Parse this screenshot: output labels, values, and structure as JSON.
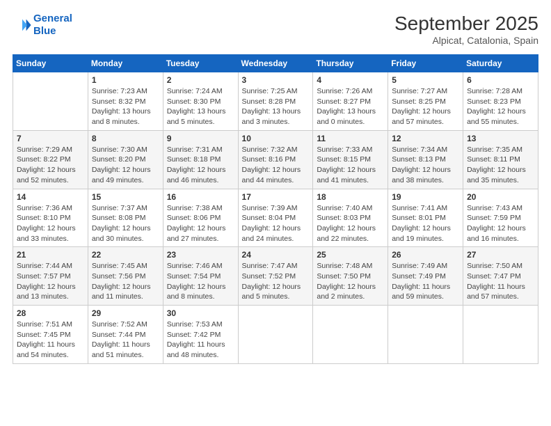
{
  "header": {
    "logo_line1": "General",
    "logo_line2": "Blue",
    "main_title": "September 2025",
    "subtitle": "Alpicat, Catalonia, Spain"
  },
  "days_of_week": [
    "Sunday",
    "Monday",
    "Tuesday",
    "Wednesday",
    "Thursday",
    "Friday",
    "Saturday"
  ],
  "weeks": [
    [
      {
        "day": "",
        "info": ""
      },
      {
        "day": "1",
        "info": "Sunrise: 7:23 AM\nSunset: 8:32 PM\nDaylight: 13 hours\nand 8 minutes."
      },
      {
        "day": "2",
        "info": "Sunrise: 7:24 AM\nSunset: 8:30 PM\nDaylight: 13 hours\nand 5 minutes."
      },
      {
        "day": "3",
        "info": "Sunrise: 7:25 AM\nSunset: 8:28 PM\nDaylight: 13 hours\nand 3 minutes."
      },
      {
        "day": "4",
        "info": "Sunrise: 7:26 AM\nSunset: 8:27 PM\nDaylight: 13 hours\nand 0 minutes."
      },
      {
        "day": "5",
        "info": "Sunrise: 7:27 AM\nSunset: 8:25 PM\nDaylight: 12 hours\nand 57 minutes."
      },
      {
        "day": "6",
        "info": "Sunrise: 7:28 AM\nSunset: 8:23 PM\nDaylight: 12 hours\nand 55 minutes."
      }
    ],
    [
      {
        "day": "7",
        "info": "Sunrise: 7:29 AM\nSunset: 8:22 PM\nDaylight: 12 hours\nand 52 minutes."
      },
      {
        "day": "8",
        "info": "Sunrise: 7:30 AM\nSunset: 8:20 PM\nDaylight: 12 hours\nand 49 minutes."
      },
      {
        "day": "9",
        "info": "Sunrise: 7:31 AM\nSunset: 8:18 PM\nDaylight: 12 hours\nand 46 minutes."
      },
      {
        "day": "10",
        "info": "Sunrise: 7:32 AM\nSunset: 8:16 PM\nDaylight: 12 hours\nand 44 minutes."
      },
      {
        "day": "11",
        "info": "Sunrise: 7:33 AM\nSunset: 8:15 PM\nDaylight: 12 hours\nand 41 minutes."
      },
      {
        "day": "12",
        "info": "Sunrise: 7:34 AM\nSunset: 8:13 PM\nDaylight: 12 hours\nand 38 minutes."
      },
      {
        "day": "13",
        "info": "Sunrise: 7:35 AM\nSunset: 8:11 PM\nDaylight: 12 hours\nand 35 minutes."
      }
    ],
    [
      {
        "day": "14",
        "info": "Sunrise: 7:36 AM\nSunset: 8:10 PM\nDaylight: 12 hours\nand 33 minutes."
      },
      {
        "day": "15",
        "info": "Sunrise: 7:37 AM\nSunset: 8:08 PM\nDaylight: 12 hours\nand 30 minutes."
      },
      {
        "day": "16",
        "info": "Sunrise: 7:38 AM\nSunset: 8:06 PM\nDaylight: 12 hours\nand 27 minutes."
      },
      {
        "day": "17",
        "info": "Sunrise: 7:39 AM\nSunset: 8:04 PM\nDaylight: 12 hours\nand 24 minutes."
      },
      {
        "day": "18",
        "info": "Sunrise: 7:40 AM\nSunset: 8:03 PM\nDaylight: 12 hours\nand 22 minutes."
      },
      {
        "day": "19",
        "info": "Sunrise: 7:41 AM\nSunset: 8:01 PM\nDaylight: 12 hours\nand 19 minutes."
      },
      {
        "day": "20",
        "info": "Sunrise: 7:43 AM\nSunset: 7:59 PM\nDaylight: 12 hours\nand 16 minutes."
      }
    ],
    [
      {
        "day": "21",
        "info": "Sunrise: 7:44 AM\nSunset: 7:57 PM\nDaylight: 12 hours\nand 13 minutes."
      },
      {
        "day": "22",
        "info": "Sunrise: 7:45 AM\nSunset: 7:56 PM\nDaylight: 12 hours\nand 11 minutes."
      },
      {
        "day": "23",
        "info": "Sunrise: 7:46 AM\nSunset: 7:54 PM\nDaylight: 12 hours\nand 8 minutes."
      },
      {
        "day": "24",
        "info": "Sunrise: 7:47 AM\nSunset: 7:52 PM\nDaylight: 12 hours\nand 5 minutes."
      },
      {
        "day": "25",
        "info": "Sunrise: 7:48 AM\nSunset: 7:50 PM\nDaylight: 12 hours\nand 2 minutes."
      },
      {
        "day": "26",
        "info": "Sunrise: 7:49 AM\nSunset: 7:49 PM\nDaylight: 11 hours\nand 59 minutes."
      },
      {
        "day": "27",
        "info": "Sunrise: 7:50 AM\nSunset: 7:47 PM\nDaylight: 11 hours\nand 57 minutes."
      }
    ],
    [
      {
        "day": "28",
        "info": "Sunrise: 7:51 AM\nSunset: 7:45 PM\nDaylight: 11 hours\nand 54 minutes."
      },
      {
        "day": "29",
        "info": "Sunrise: 7:52 AM\nSunset: 7:44 PM\nDaylight: 11 hours\nand 51 minutes."
      },
      {
        "day": "30",
        "info": "Sunrise: 7:53 AM\nSunset: 7:42 PM\nDaylight: 11 hours\nand 48 minutes."
      },
      {
        "day": "",
        "info": ""
      },
      {
        "day": "",
        "info": ""
      },
      {
        "day": "",
        "info": ""
      },
      {
        "day": "",
        "info": ""
      }
    ]
  ]
}
